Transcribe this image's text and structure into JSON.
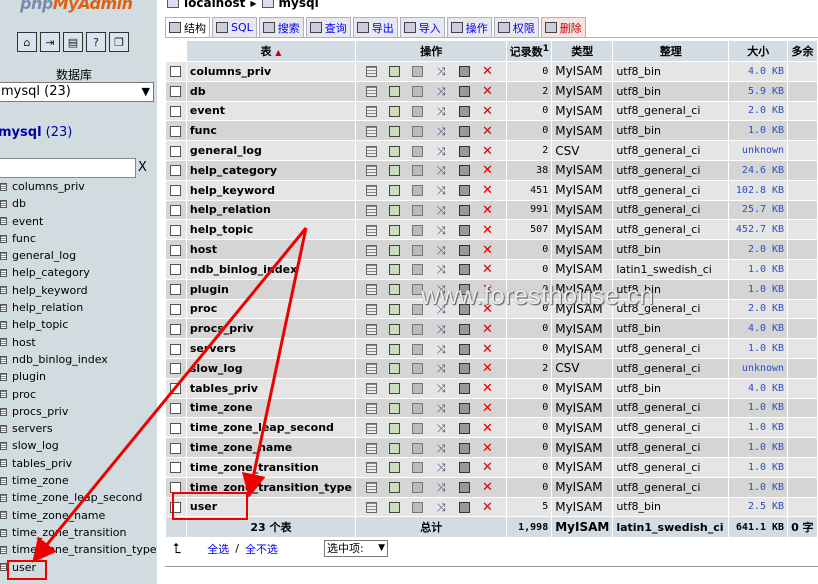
{
  "left": {
    "logo_prefix": "php",
    "logo_main": "MyAdmin",
    "db_label": "数据库",
    "db_select_value": "mysql (23)",
    "db_title_name": "mysql",
    "db_title_count": "(23)",
    "filter_clear": "X",
    "tables": [
      "columns_priv",
      "db",
      "event",
      "func",
      "general_log",
      "help_category",
      "help_keyword",
      "help_relation",
      "help_topic",
      "host",
      "ndb_binlog_index",
      "plugin",
      "proc",
      "procs_priv",
      "servers",
      "slow_log",
      "tables_priv",
      "time_zone",
      "time_zone_leap_second",
      "time_zone_name",
      "time_zone_transition",
      "time_zone_transition_type",
      "user"
    ]
  },
  "crumb": {
    "server": "localhost",
    "db": "mysql"
  },
  "tabs": [
    {
      "label": "结构",
      "active": true
    },
    {
      "label": "SQL"
    },
    {
      "label": "搜索"
    },
    {
      "label": "查询"
    },
    {
      "label": "导出"
    },
    {
      "label": "导入"
    },
    {
      "label": "操作"
    },
    {
      "label": "权限"
    },
    {
      "label": "删除"
    }
  ],
  "header": {
    "table": "表",
    "sort_arrow": "▲",
    "actions": "操作",
    "records": "记录数",
    "records_note": "1",
    "type": "类型",
    "collation": "整理",
    "size": "大小",
    "overhead": "多余"
  },
  "rows": [
    {
      "name": "columns_priv",
      "rows": "0",
      "type": "MyISAM",
      "coll": "utf8_bin",
      "size": "4.0 KB"
    },
    {
      "name": "db",
      "rows": "2",
      "type": "MyISAM",
      "coll": "utf8_bin",
      "size": "5.9 KB"
    },
    {
      "name": "event",
      "rows": "0",
      "type": "MyISAM",
      "coll": "utf8_general_ci",
      "size": "2.0 KB"
    },
    {
      "name": "func",
      "rows": "0",
      "type": "MyISAM",
      "coll": "utf8_bin",
      "size": "1.0 KB"
    },
    {
      "name": "general_log",
      "rows": "2",
      "type": "CSV",
      "coll": "utf8_general_ci",
      "size": "unknown"
    },
    {
      "name": "help_category",
      "rows": "38",
      "type": "MyISAM",
      "coll": "utf8_general_ci",
      "size": "24.6 KB"
    },
    {
      "name": "help_keyword",
      "rows": "451",
      "type": "MyISAM",
      "coll": "utf8_general_ci",
      "size": "102.8 KB"
    },
    {
      "name": "help_relation",
      "rows": "991",
      "type": "MyISAM",
      "coll": "utf8_general_ci",
      "size": "25.7 KB"
    },
    {
      "name": "help_topic",
      "rows": "507",
      "type": "MyISAM",
      "coll": "utf8_general_ci",
      "size": "452.7 KB"
    },
    {
      "name": "host",
      "rows": "0",
      "type": "MyISAM",
      "coll": "utf8_bin",
      "size": "2.0 KB"
    },
    {
      "name": "ndb_binlog_index",
      "rows": "0",
      "type": "MyISAM",
      "coll": "latin1_swedish_ci",
      "size": "1.0 KB"
    },
    {
      "name": "plugin",
      "rows": "0",
      "type": "MyISAM",
      "coll": "utf8_bin",
      "size": "1.0 KB"
    },
    {
      "name": "proc",
      "rows": "0",
      "type": "MyISAM",
      "coll": "utf8_general_ci",
      "size": "2.0 KB"
    },
    {
      "name": "procs_priv",
      "rows": "0",
      "type": "MyISAM",
      "coll": "utf8_bin",
      "size": "4.0 KB"
    },
    {
      "name": "servers",
      "rows": "0",
      "type": "MyISAM",
      "coll": "utf8_general_ci",
      "size": "1.0 KB"
    },
    {
      "name": "slow_log",
      "rows": "2",
      "type": "CSV",
      "coll": "utf8_general_ci",
      "size": "unknown"
    },
    {
      "name": "tables_priv",
      "rows": "0",
      "type": "MyISAM",
      "coll": "utf8_bin",
      "size": "4.0 KB"
    },
    {
      "name": "time_zone",
      "rows": "0",
      "type": "MyISAM",
      "coll": "utf8_general_ci",
      "size": "1.0 KB"
    },
    {
      "name": "time_zone_leap_second",
      "rows": "0",
      "type": "MyISAM",
      "coll": "utf8_general_ci",
      "size": "1.0 KB"
    },
    {
      "name": "time_zone_name",
      "rows": "0",
      "type": "MyISAM",
      "coll": "utf8_general_ci",
      "size": "1.0 KB"
    },
    {
      "name": "time_zone_transition",
      "rows": "0",
      "type": "MyISAM",
      "coll": "utf8_general_ci",
      "size": "1.0 KB"
    },
    {
      "name": "time_zone_transition_type",
      "rows": "0",
      "type": "MyISAM",
      "coll": "utf8_general_ci",
      "size": "1.0 KB"
    },
    {
      "name": "user",
      "rows": "5",
      "type": "MyISAM",
      "coll": "utf8_bin",
      "size": "2.5 KB"
    }
  ],
  "footer": {
    "table_count": "23 个表",
    "total": "总计",
    "rows": "1,998",
    "type": "MyISAM",
    "coll": "latin1_swedish_ci",
    "size": "641.1 KB",
    "overhead": "0 字"
  },
  "bottom": {
    "check_all": "全选",
    "separator": "/",
    "uncheck_all": "全不选",
    "with_selected": "选中项:"
  },
  "watermark": "www.foresthouse.cn",
  "colors": {
    "left_bg": "#D0DCE0",
    "header_bg": "#D3DCE3",
    "row_odd": "#E5E5E5",
    "row_even": "#D5D5D5",
    "annotation": "#E00000"
  }
}
